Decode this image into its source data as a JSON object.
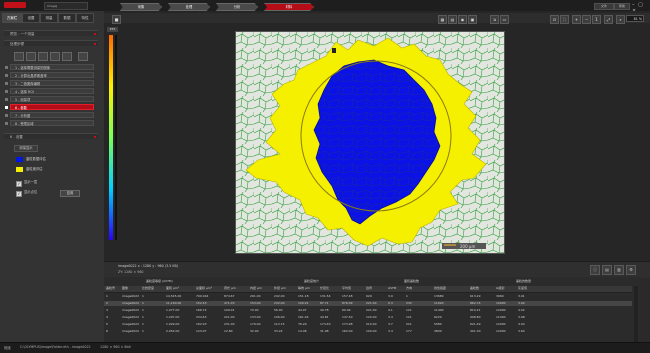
{
  "app": {
    "title_left": "ImageJ",
    "window_controls": [
      "minimize",
      "maximize",
      "close"
    ]
  },
  "top_right": {
    "btn1": "文件",
    "btn2": "帮助"
  },
  "left_tabs": [
    {
      "label": "方案栏"
    },
    {
      "label": "设置"
    },
    {
      "label": "测量"
    },
    {
      "label": "数据"
    },
    {
      "label": "特性"
    }
  ],
  "sections": {
    "s1": "预览 - 一个测量",
    "s2": "处理步骤",
    "s3": "6 - 设置"
  },
  "workflow_steps": [
    {
      "label": "1 - 选择需要测量的图像"
    },
    {
      "label": "2 - 计算出晶界覆盖率"
    },
    {
      "label": "3 - 二值图像编辑"
    },
    {
      "label": "4 - 选择 ROI"
    },
    {
      "label": "5 - 测量项"
    },
    {
      "label": "6 - 参数"
    },
    {
      "label": "7 - 分析图"
    },
    {
      "label": "8 - 受限区域"
    }
  ],
  "active_step_index": 5,
  "legend": {
    "title": "测量显示",
    "items": [
      {
        "label": "晶粒数据评估",
        "color": "#0018e0"
      },
      {
        "label": "晶粒度评估",
        "color": "#f5f000"
      }
    ]
  },
  "checks": [
    {
      "label": "显示一层",
      "checked": true
    },
    {
      "label": "显示点位",
      "checked": true
    }
  ],
  "check_button": "应用",
  "workflow_tabs": [
    {
      "label": "采集"
    },
    {
      "label": "处理"
    },
    {
      "label": "分析"
    },
    {
      "label": "材料"
    }
  ],
  "active_workflow_tab": 3,
  "zoom": "81 %",
  "colorbar_top": "255",
  "info": {
    "line1": "image0022  x : 1280 y : 960  (3.5 KB)",
    "line2": "ZY: 1280 × 960"
  },
  "scalebar_label": "200 µm",
  "table": {
    "group_headers": [
      "晶粒度等级 (ASTM)",
      "晶粒度统计",
      "晶粒面积",
      "面积晶粒数",
      "晶粒的数量"
    ],
    "columns": [
      "晶粒号",
      "图像",
      "比较密度",
      "面积 µm²",
      "总面积 µm²",
      "周长 µm",
      "内径 µm",
      "外径 µm",
      "等效 µm",
      "长径比",
      "平均值",
      "边界",
      "ASTM",
      "方向",
      "线性截距",
      "晶粒数",
      "G级别",
      "灰度值"
    ],
    "rows": [
      [
        "1",
        "image0022",
        "1",
        "14,545.00",
        "790.044",
        "874.67",
        "291.00",
        "242.00",
        "151.18",
        "131.54",
        "157.48",
        "929",
        "3.9",
        "1",
        "13680",
        "613.29",
        "3960",
        "3.91"
      ],
      [
        "2",
        "image0022",
        "1",
        "11,190.00",
        "152.43",
        "471.03",
        "153.00",
        "232.00",
        "100.91",
        "87.71",
        "876.09",
        "221.00",
        "0.3",
        "232",
        "11620",
        "862.74",
        "10000",
        "3.94"
      ],
      [
        "3",
        "image0022",
        "1",
        "1,077.00",
        "166.74",
        "109.01",
        "70.00",
        "56.00",
        "44.07",
        "40.78",
        "60.09",
        "221.00",
        "4.1",
        "121",
        "11400",
        "810.21",
        "12000",
        "4.02"
      ],
      [
        "4",
        "image0022",
        "1",
        "1,297.00",
        "234.63",
        "221.00",
        "133.00",
        "106.00",
        "161.04",
        "44.81",
        "147.40",
        "120.00",
        "3.4",
        "121",
        "6220",
        "908.80",
        "11000",
        "3.98"
      ],
      [
        "5",
        "image0022",
        "1",
        "1,029.00",
        "162.93",
        "231.00",
        "179.00",
        "112.15",
        "76.29",
        "174.40",
        "173.98",
        "210.00",
        "3.7",
        "221",
        "5980",
        "621.49",
        "12000",
        "4.04"
      ],
      [
        "6",
        "image0022",
        "1",
        "2,052.00",
        "123.07",
        "12.80",
        "32.00",
        "33.24",
        "14.48",
        "31.08",
        "162.00",
        "100.00",
        "3.4",
        "177",
        "3800",
        "401.30",
        "12000",
        "3.64"
      ]
    ]
  },
  "statusbar": {
    "left": "就绪",
    "path": "C:\\OLYMPUS\\image\\Folder.eth - image0022",
    "right": "1280 × 960 × 8bit"
  }
}
